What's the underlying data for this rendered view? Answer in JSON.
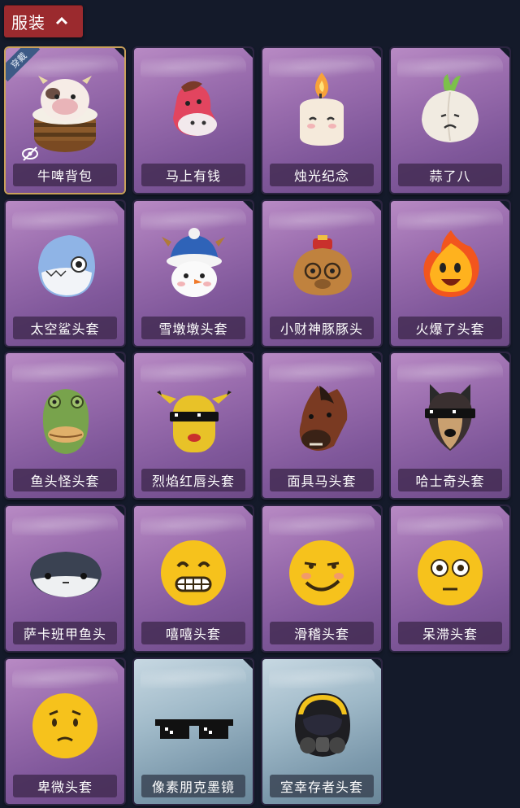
{
  "header": {
    "tab_label": "服装"
  },
  "items": [
    {
      "name": "牛啤背包",
      "badge": "穿戴"
    },
    {
      "name": "马上有钱"
    },
    {
      "name": "烛光纪念"
    },
    {
      "name": "蒜了八"
    },
    {
      "name": "太空鲨头套"
    },
    {
      "name": "雪墩墩头套"
    },
    {
      "name": "小财神豚豚头"
    },
    {
      "name": "火爆了头套"
    },
    {
      "name": "鱼头怪头套"
    },
    {
      "name": "烈焰红唇头套"
    },
    {
      "name": "面具马头套"
    },
    {
      "name": "哈士奇头套"
    },
    {
      "name": "萨卡班甲鱼头"
    },
    {
      "name": "嘻嘻头套"
    },
    {
      "name": "滑稽头套"
    },
    {
      "name": "呆滞头套"
    },
    {
      "name": "卑微头套"
    },
    {
      "name": "像素朋克墨镜"
    },
    {
      "name": "室幸存者头套"
    }
  ],
  "colors": {
    "background": "#141a2a",
    "tab": "#9b2a2e",
    "card_purple": "#9a6dae",
    "card_blue": "#9fb9c8",
    "selected_border": "#c9a15a"
  }
}
